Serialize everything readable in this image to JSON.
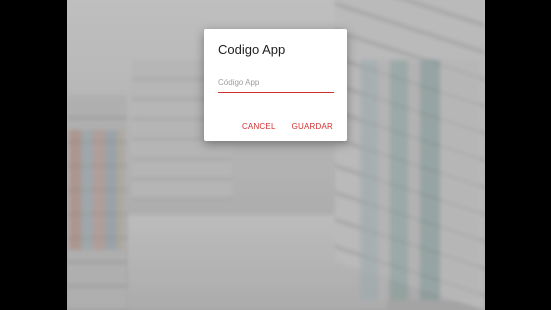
{
  "dialog": {
    "title": "Codigo App",
    "input": {
      "value": "",
      "placeholder": "Código App"
    },
    "buttons": {
      "cancel_label": "CANCEL",
      "save_label": "GUARDAR"
    }
  },
  "colors": {
    "accent": "#d32f2f",
    "dialog_background": "#ffffff",
    "letterbox": "#000000"
  }
}
